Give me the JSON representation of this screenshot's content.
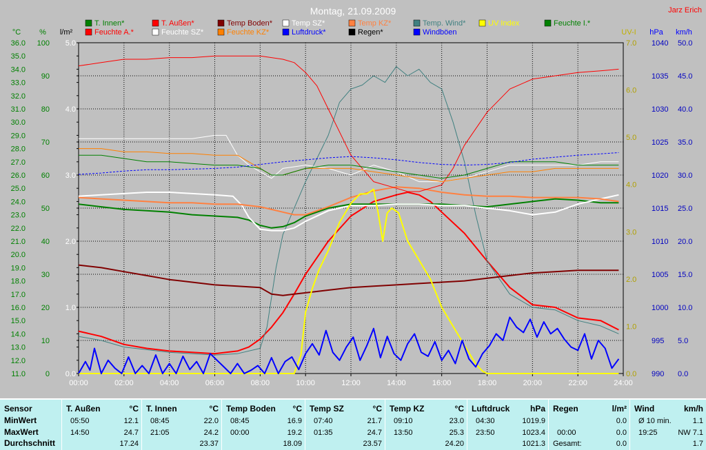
{
  "window": {
    "title": "Montag, 21.09.2009",
    "author": "Jarz Erich"
  },
  "legend": [
    {
      "label": "T. Innen*",
      "color": "#008000"
    },
    {
      "label": "T. Außen*",
      "color": "#ff0000"
    },
    {
      "label": "Temp Boden*",
      "color": "#800000"
    },
    {
      "label": "Temp SZ*",
      "color": "#ffffff"
    },
    {
      "label": "Temp KZ*",
      "color": "#ff8040"
    },
    {
      "label": "Temp. Wind*",
      "color": "#408080"
    },
    {
      "label": "UV Index",
      "color": "#ffff00"
    },
    {
      "label": "Feuchte I.*",
      "color": "#008000"
    },
    {
      "label": "Feuchte A.*",
      "color": "#ff0000"
    },
    {
      "label": "Feuchte SZ*",
      "color": "#ffffff"
    },
    {
      "label": "Feuchte KZ*",
      "color": "#ff8000"
    },
    {
      "label": "Luftdruck*",
      "color": "#0000ff"
    },
    {
      "label": "Regen*",
      "color": "#000000"
    },
    {
      "label": "Windböen",
      "color": "#0000ff"
    }
  ],
  "chart_data": {
    "type": "line",
    "title": "Montag, 21.09.2009",
    "x_ticks": [
      "00:00",
      "02:00",
      "04:00",
      "06:00",
      "08:00",
      "10:00",
      "12:00",
      "14:00",
      "16:00",
      "18:00",
      "20:00",
      "22:00",
      "24:00"
    ],
    "axes": {
      "temp": {
        "unit": "°C",
        "range": [
          11.0,
          36.0
        ],
        "ticks": [
          "11.0",
          "12.0",
          "13.0",
          "14.0",
          "15.0",
          "16.0",
          "17.0",
          "18.0",
          "19.0",
          "20.0",
          "21.0",
          "22.0",
          "23.0",
          "24.0",
          "25.0",
          "26.0",
          "27.0",
          "28.0",
          "29.0",
          "30.0",
          "31.0",
          "32.0",
          "33.0",
          "34.0",
          "35.0",
          "36.0"
        ]
      },
      "humidity": {
        "unit": "%",
        "range": [
          0,
          100
        ],
        "ticks": [
          "0",
          "10",
          "20",
          "30",
          "40",
          "50",
          "60",
          "70",
          "80",
          "90",
          "100"
        ]
      },
      "rain": {
        "unit": "l/m²",
        "range": [
          0.0,
          5.0
        ],
        "ticks": [
          "0.0",
          "1.0",
          "2.0",
          "3.0",
          "4.0",
          "5.0"
        ]
      },
      "uv": {
        "unit": "UV-I",
        "range": [
          0.0,
          7.0
        ],
        "ticks": [
          "0.0",
          "1.0",
          "2.0",
          "3.0",
          "4.0",
          "5.0",
          "6.0",
          "7.0"
        ]
      },
      "pressure": {
        "unit": "hPa",
        "range": [
          990,
          1040
        ],
        "ticks": [
          "990",
          "995",
          "1000",
          "1005",
          "1010",
          "1015",
          "1020",
          "1025",
          "1030",
          "1035",
          "1040"
        ]
      },
      "wind": {
        "unit": "km/h",
        "range": [
          0.0,
          50.0
        ],
        "ticks": [
          "0.0",
          "5.0",
          "10.0",
          "15.0",
          "20.0",
          "25.0",
          "30.0",
          "35.0",
          "40.0",
          "45.0",
          "50.0"
        ]
      }
    },
    "series": [
      {
        "name": "T. Außen*",
        "axis": "temp",
        "color": "#ff0000",
        "width": 2,
        "x": [
          0,
          1,
          2,
          3,
          4,
          5,
          6,
          6.5,
          7,
          7.5,
          8,
          8.5,
          9,
          9.5,
          10,
          11,
          12,
          13,
          14,
          14.5,
          15,
          15.5,
          16,
          17,
          18,
          19,
          20,
          21,
          22,
          23,
          23.8
        ],
        "y": [
          14.2,
          13.8,
          13.2,
          12.9,
          12.7,
          12.6,
          12.5,
          12.6,
          12.7,
          13.0,
          13.6,
          14.5,
          15.6,
          17.0,
          18.5,
          21.0,
          22.9,
          24.0,
          24.5,
          24.7,
          24.5,
          24.0,
          23.2,
          21.6,
          19.5,
          17.5,
          16.2,
          16.0,
          15.2,
          15.0,
          14.3
        ]
      },
      {
        "name": "Temp. Wind*",
        "axis": "temp",
        "color": "#408080",
        "width": 1,
        "x": [
          0,
          1,
          2,
          3,
          4,
          5,
          6,
          7,
          8,
          8.3,
          8.7,
          9,
          10,
          11,
          11.5,
          12,
          12.5,
          13,
          13.5,
          14,
          14.5,
          15,
          15.5,
          16,
          16.5,
          17,
          17.5,
          18,
          19,
          20,
          21,
          22,
          23,
          23.8
        ],
        "y": [
          13.8,
          13.5,
          13.0,
          12.8,
          12.6,
          12.5,
          12.4,
          12.5,
          12.9,
          14.5,
          19.0,
          21.5,
          25.5,
          29.0,
          31.5,
          32.5,
          32.8,
          33.5,
          33.0,
          34.2,
          33.5,
          34.0,
          33.0,
          32.5,
          30.0,
          27.0,
          23.0,
          19.5,
          17.0,
          16.0,
          15.8,
          15.0,
          14.6,
          14.0
        ]
      },
      {
        "name": "T. Innen*",
        "axis": "temp",
        "color": "#008000",
        "width": 2,
        "x": [
          0,
          1,
          2,
          3,
          4,
          5,
          6,
          7,
          7.5,
          8,
          8.5,
          9,
          9.5,
          10,
          11,
          12,
          13,
          14,
          15,
          16,
          17,
          18,
          19,
          20,
          21,
          22,
          23,
          23.8
        ],
        "y": [
          23.8,
          23.6,
          23.4,
          23.3,
          23.2,
          23.0,
          22.9,
          22.8,
          22.6,
          22.2,
          22.0,
          22.1,
          22.4,
          22.9,
          23.5,
          23.8,
          23.8,
          23.8,
          23.8,
          23.8,
          23.7,
          23.6,
          23.8,
          24.0,
          24.2,
          24.1,
          23.9,
          23.9
        ]
      },
      {
        "name": "Temp SZ*",
        "axis": "temp",
        "color": "#ffffff",
        "width": 2,
        "x": [
          0,
          1,
          2,
          3,
          4,
          5,
          6,
          6.8,
          7.2,
          7.5,
          8,
          8.5,
          9,
          9.5,
          10,
          11,
          12,
          13,
          14,
          15,
          16,
          17,
          18,
          19,
          20,
          21,
          22,
          23,
          23.8
        ],
        "y": [
          24.4,
          24.5,
          24.6,
          24.7,
          24.7,
          24.6,
          24.5,
          24.4,
          23.7,
          22.8,
          21.9,
          21.8,
          21.8,
          22.0,
          22.5,
          23.3,
          23.7,
          23.7,
          23.8,
          23.8,
          23.7,
          23.7,
          23.5,
          23.3,
          23.0,
          23.2,
          23.8,
          24.2,
          24.5
        ]
      },
      {
        "name": "Temp KZ*",
        "axis": "temp",
        "color": "#ff8040",
        "width": 2,
        "x": [
          0,
          1,
          2,
          3,
          4,
          5,
          6,
          7,
          8,
          8.5,
          9,
          9.5,
          10,
          11,
          12,
          13,
          14,
          15,
          16,
          17,
          18,
          19,
          20,
          21,
          22,
          23,
          23.8
        ],
        "y": [
          24.3,
          24.2,
          24.1,
          24.0,
          23.9,
          23.9,
          23.8,
          23.8,
          23.6,
          23.4,
          23.2,
          23.0,
          23.0,
          23.6,
          24.3,
          24.8,
          25.1,
          25.0,
          24.7,
          24.5,
          24.4,
          24.4,
          24.3,
          24.3,
          24.3,
          24.2,
          24.0
        ]
      },
      {
        "name": "Temp Boden*",
        "axis": "temp",
        "color": "#800000",
        "width": 2,
        "x": [
          0,
          1,
          2,
          3,
          4,
          5,
          6,
          7,
          8,
          8.5,
          9,
          9.5,
          10,
          11,
          12,
          13,
          14,
          15,
          16,
          17,
          18,
          19,
          20,
          21,
          22,
          23,
          23.8
        ],
        "y": [
          19.2,
          19.0,
          18.7,
          18.4,
          18.1,
          17.9,
          17.7,
          17.6,
          17.5,
          17.0,
          16.9,
          17.0,
          17.1,
          17.3,
          17.5,
          17.6,
          17.7,
          17.8,
          17.9,
          18.0,
          18.2,
          18.4,
          18.6,
          18.7,
          18.8,
          18.8,
          18.8
        ]
      },
      {
        "name": "Feuchte A.*",
        "axis": "humidity",
        "color": "#ff0000",
        "width": 1,
        "x": [
          0,
          1,
          2,
          3,
          4,
          5,
          6,
          7,
          8,
          9,
          9.5,
          10,
          10.5,
          11,
          12,
          13,
          14,
          14.5,
          15,
          16,
          16.5,
          17,
          18,
          19,
          20,
          21,
          22,
          23,
          23.8
        ],
        "y": [
          93,
          94,
          95,
          95,
          95.5,
          95.5,
          96,
          96,
          96,
          95,
          94,
          91,
          87,
          80,
          66,
          58,
          56,
          55,
          55,
          57,
          62,
          69,
          79,
          86,
          89,
          90,
          91,
          91.5,
          92
        ]
      },
      {
        "name": "Feuchte SZ*",
        "axis": "humidity",
        "color": "#ffffff",
        "width": 1,
        "x": [
          0,
          1,
          2,
          3,
          4,
          5,
          6,
          6.5,
          7,
          7.5,
          8,
          8.5,
          9,
          10,
          11,
          12,
          13,
          14,
          15,
          16,
          17,
          18,
          19,
          20,
          21,
          22,
          23,
          23.8
        ],
        "y": [
          71,
          71,
          71,
          71,
          71,
          71,
          72,
          72,
          66,
          63,
          61,
          59,
          62,
          63,
          62,
          60,
          63,
          61,
          58,
          58,
          59,
          61,
          63,
          63,
          63,
          63,
          64,
          64
        ]
      },
      {
        "name": "Feuchte KZ*",
        "axis": "humidity",
        "color": "#ff8000",
        "width": 1,
        "x": [
          0,
          1,
          2,
          3,
          4,
          5,
          6,
          7,
          8,
          8.5,
          9,
          10,
          11,
          12,
          13,
          14,
          15,
          16,
          17,
          18,
          19,
          20,
          21,
          22,
          23,
          23.8
        ],
        "y": [
          68,
          68,
          67,
          67,
          66.5,
          66.5,
          66,
          66,
          62,
          60,
          60,
          62,
          62,
          62,
          61,
          60,
          59,
          58,
          59,
          60,
          61,
          61,
          62,
          62,
          62,
          62
        ]
      },
      {
        "name": "Feuchte I.*",
        "axis": "humidity",
        "color": "#008000",
        "width": 1,
        "x": [
          0,
          1,
          2,
          3,
          4,
          5,
          6,
          7,
          8,
          8.5,
          9,
          10,
          11,
          12,
          13,
          14,
          15,
          16,
          17,
          18,
          19,
          20,
          21,
          22,
          23,
          23.8
        ],
        "y": [
          66,
          66,
          65,
          64,
          64,
          63.5,
          63,
          63,
          62,
          60,
          60,
          62,
          63,
          63,
          62,
          61,
          60,
          59,
          60,
          62,
          64,
          64,
          64,
          63,
          63,
          63
        ]
      },
      {
        "name": "Luftdruck*",
        "axis": "pressure",
        "color": "#0000ff",
        "width": 1,
        "dash": "3,2",
        "x": [
          0,
          1,
          2,
          3,
          4,
          5,
          6,
          7,
          8,
          9,
          10,
          11,
          12,
          13,
          14,
          15,
          16,
          17,
          18,
          19,
          20,
          21,
          22,
          23,
          23.8
        ],
        "y": [
          1020.1,
          1020.3,
          1020.6,
          1020.8,
          1020.8,
          1020.9,
          1021.0,
          1021.2,
          1021.6,
          1022.0,
          1022.3,
          1022.6,
          1022.8,
          1022.6,
          1022.3,
          1021.9,
          1021.6,
          1021.5,
          1021.6,
          1021.9,
          1022.4,
          1022.7,
          1023.0,
          1023.2,
          1023.4
        ]
      },
      {
        "name": "UV Index",
        "axis": "uv",
        "color": "#ffff00",
        "width": 2,
        "x": [
          0,
          9.5,
          9.8,
          10,
          10.3,
          10.6,
          11,
          11.5,
          12,
          12.4,
          12.7,
          13,
          13.2,
          13.4,
          13.6,
          13.8,
          14.1,
          14.5,
          15,
          15.5,
          16,
          16.5,
          17,
          17.5,
          17.8,
          18,
          20,
          23.8
        ],
        "y": [
          0,
          0,
          0.4,
          1.3,
          1.8,
          2.2,
          2.6,
          3.2,
          3.6,
          3.8,
          3.8,
          3.9,
          3.4,
          2.8,
          3.4,
          3.5,
          3.4,
          2.8,
          2.4,
          2.0,
          1.4,
          1.0,
          0.6,
          0.2,
          0.05,
          0,
          0,
          0
        ]
      },
      {
        "name": "Windböen",
        "axis": "wind",
        "color": "#0000ff",
        "width": 2,
        "x": [
          0,
          0.3,
          0.5,
          0.7,
          1.0,
          1.3,
          1.6,
          1.9,
          2.2,
          2.5,
          2.8,
          3.1,
          3.4,
          3.7,
          4.0,
          4.3,
          4.6,
          4.9,
          5.2,
          5.5,
          5.8,
          6.1,
          6.4,
          6.7,
          7.0,
          7.3,
          7.6,
          7.9,
          8.2,
          8.5,
          8.8,
          9.1,
          9.4,
          9.7,
          10.0,
          10.3,
          10.6,
          10.9,
          11.2,
          11.5,
          11.8,
          12.1,
          12.4,
          12.7,
          13.0,
          13.3,
          13.6,
          13.9,
          14.2,
          14.5,
          14.8,
          15.1,
          15.4,
          15.7,
          16.0,
          16.3,
          16.6,
          16.9,
          17.2,
          17.5,
          17.8,
          18.1,
          18.4,
          18.7,
          19.0,
          19.3,
          19.6,
          19.9,
          20.2,
          20.5,
          20.8,
          21.1,
          21.4,
          21.7,
          22.0,
          22.3,
          22.6,
          22.9,
          23.2,
          23.5,
          23.8
        ],
        "y": [
          0,
          1.8,
          0.5,
          3.8,
          0,
          2.0,
          0.8,
          0,
          2.5,
          0,
          1.2,
          0,
          2.8,
          0,
          1.5,
          0,
          2.6,
          0.6,
          1.8,
          0,
          3.0,
          2.0,
          1.0,
          0,
          1.5,
          0,
          0.5,
          1.2,
          0,
          2.4,
          0,
          1.8,
          2.5,
          0.6,
          3.0,
          4.5,
          2.8,
          6.5,
          3.2,
          2.0,
          4.0,
          5.5,
          2.0,
          4.2,
          6.8,
          2.4,
          5.6,
          3.0,
          2.0,
          4.5,
          6.0,
          3.2,
          2.6,
          4.8,
          2.0,
          3.5,
          1.5,
          5.0,
          2.2,
          1.0,
          3.0,
          4.2,
          6.0,
          5.0,
          8.5,
          7.0,
          6.2,
          8.2,
          5.5,
          7.8,
          6.0,
          6.8,
          5.2,
          4.0,
          3.5,
          6.0,
          2.2,
          5.0,
          3.8,
          0.8,
          2.2
        ]
      }
    ]
  },
  "stats": {
    "row_labels": {
      "sensor": "Sensor",
      "min": "MinWert",
      "max": "MaxWert",
      "avg": "Durchschnitt"
    },
    "columns": [
      {
        "name": "T. Außen",
        "unit": "°C",
        "min_time": "05:50",
        "min": "12.1",
        "max_time": "14:50",
        "max": "24.7",
        "avg": "17.24"
      },
      {
        "name": "T. Innen",
        "unit": "°C",
        "min_time": "08:45",
        "min": "22.0",
        "max_time": "21:05",
        "max": "24.2",
        "avg": "23.37"
      },
      {
        "name": "Temp Boden",
        "unit": "°C",
        "min_time": "08:45",
        "min": "16.9",
        "max_time": "00:00",
        "max": "19.2",
        "avg": "18.09"
      },
      {
        "name": "Temp SZ",
        "unit": "°C",
        "min_time": "07:40",
        "min": "21.7",
        "max_time": "01:35",
        "max": "24.7",
        "avg": "23.57"
      },
      {
        "name": "Temp KZ",
        "unit": "°C",
        "min_time": "09:10",
        "min": "23.0",
        "max_time": "13:50",
        "max": "25.3",
        "avg": "24.20"
      },
      {
        "name": "Luftdruck",
        "unit": "hPa",
        "min_time": "04:30",
        "min": "1019.9",
        "max_time": "23:50",
        "max": "1023.4",
        "avg": "1021.3"
      }
    ],
    "rain": {
      "name": "Regen",
      "unit": "l/m²",
      "r1_time": "",
      "r1": "0.0",
      "r2_time": "00:00",
      "r2": "0.0",
      "r3_label": "Gesamt:",
      "r3": "0.0"
    },
    "wind": {
      "name": "Wind",
      "unit": "km/h",
      "r1_label": "Ø 10 min.",
      "r1": "1.1",
      "r2_time": "19:25",
      "r2": "NW 7.1",
      "r3": "1.7"
    }
  }
}
